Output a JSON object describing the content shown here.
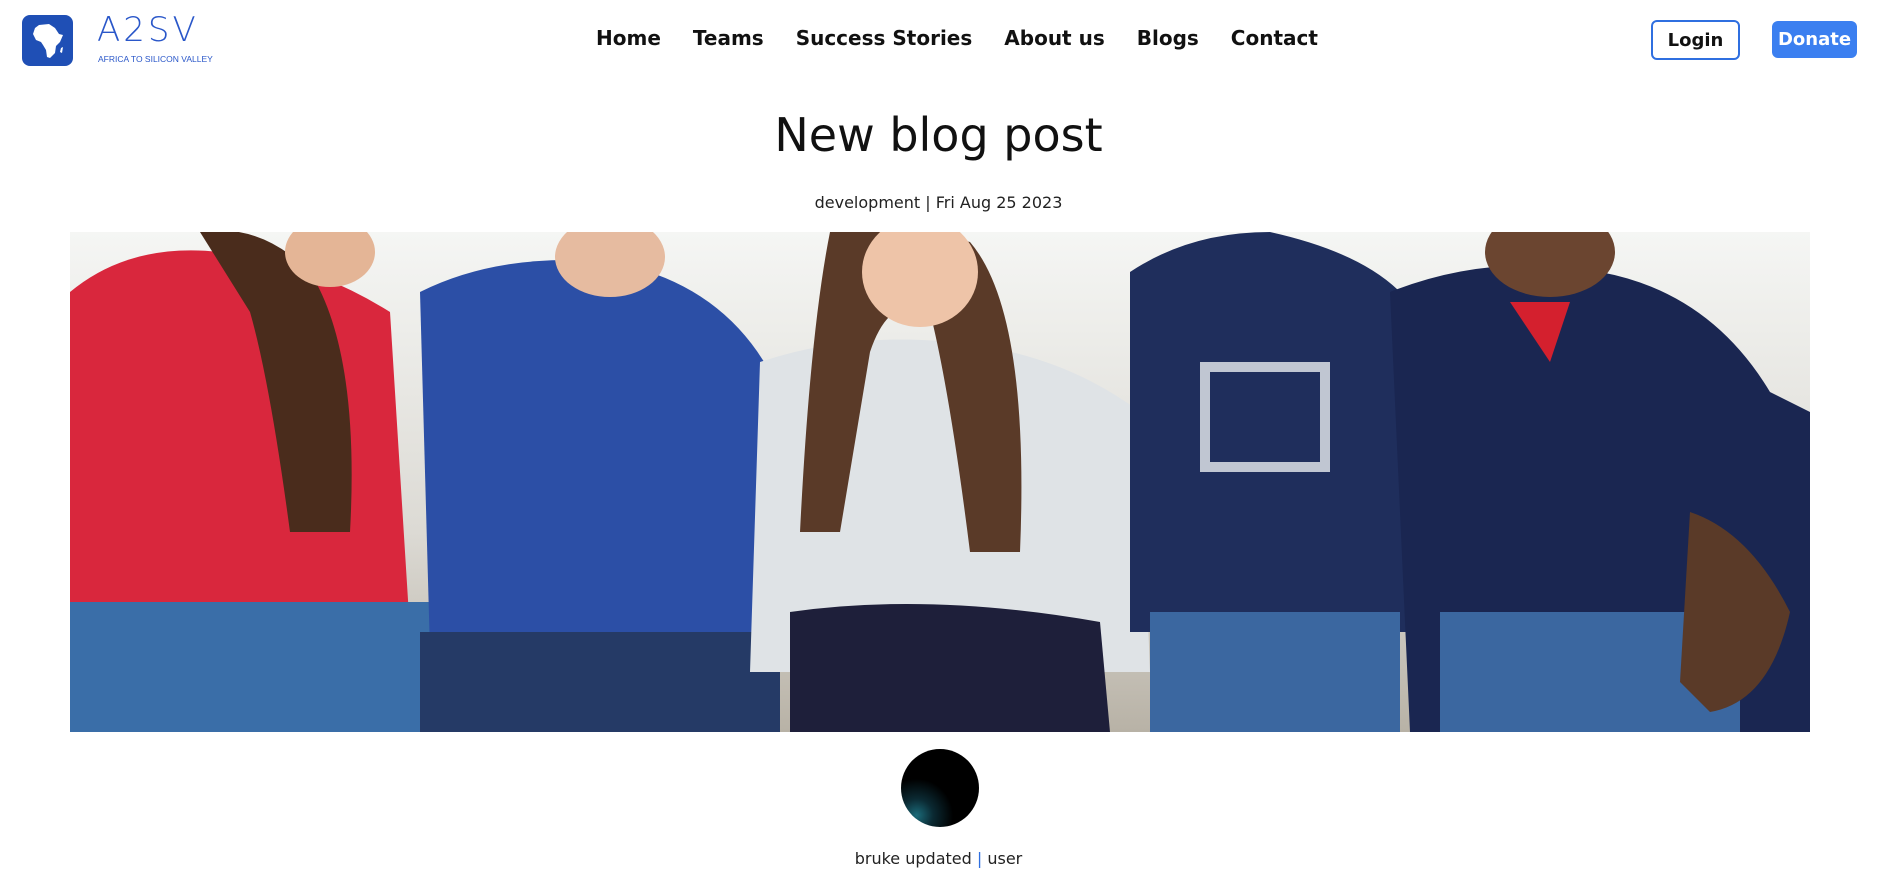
{
  "header": {
    "logo_mark": "A2SV",
    "logo_tagline": "AFRICA TO SILICON VALLEY",
    "nav": [
      {
        "label": "Home"
      },
      {
        "label": "Teams"
      },
      {
        "label": "Success Stories"
      },
      {
        "label": "About us"
      },
      {
        "label": "Blogs"
      },
      {
        "label": "Contact"
      }
    ],
    "login_label": "Login",
    "donate_label": "Donate"
  },
  "post": {
    "title": "New blog post",
    "category": "development",
    "separator": "|",
    "date": "Fri Aug 25 2023",
    "author": "bruke updated",
    "author_separator": "|",
    "role": "user"
  },
  "colors": {
    "brand": "#1f4fb5",
    "accent": "#3b7ff0"
  }
}
